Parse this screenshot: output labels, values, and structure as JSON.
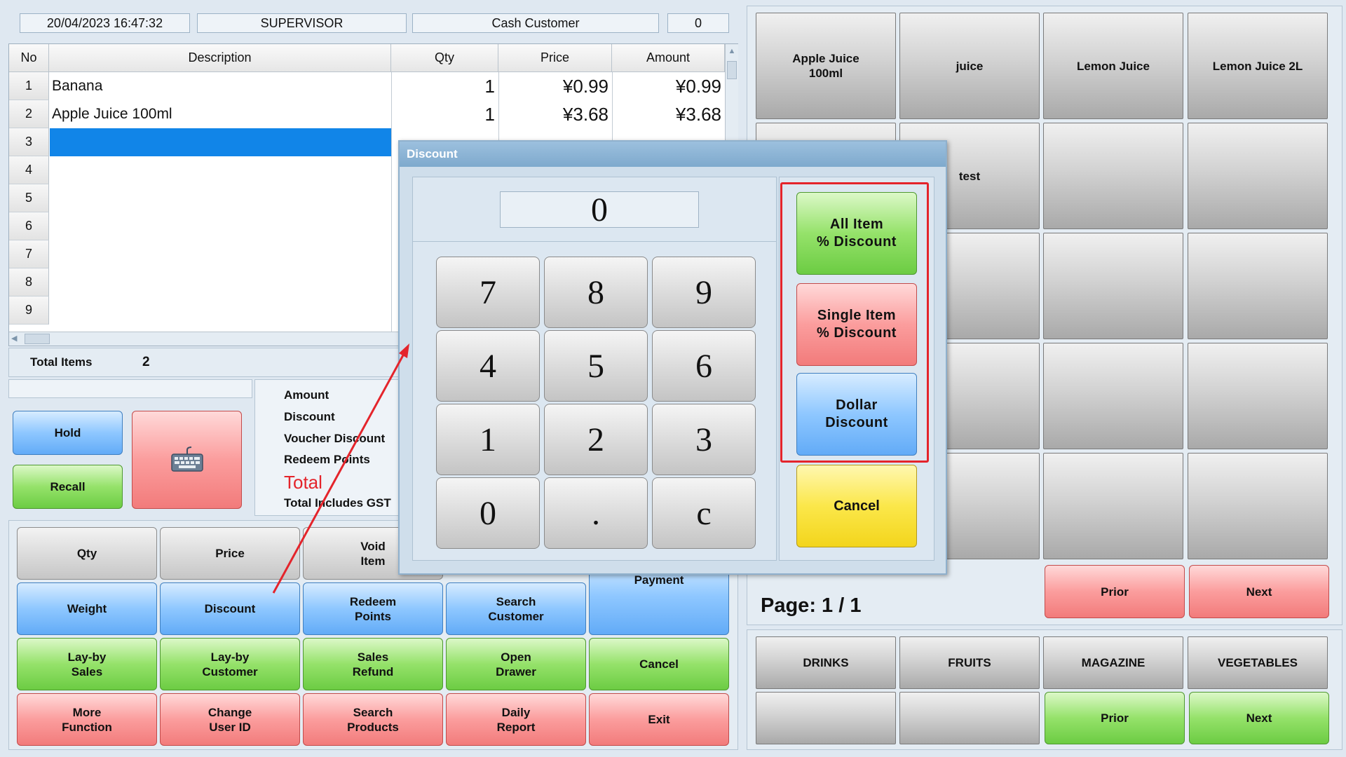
{
  "header": {
    "datetime": "20/04/2023  16:47:32",
    "user": "SUPERVISOR",
    "customer": "Cash Customer",
    "counter": "0"
  },
  "grid": {
    "columns": [
      "No",
      "Description",
      "Qty",
      "Price",
      "Amount"
    ],
    "rows": [
      {
        "no": "1",
        "description": "Banana",
        "qty": "1",
        "price": "¥0.99",
        "amount": "¥0.99"
      },
      {
        "no": "2",
        "description": "Apple Juice 100ml",
        "qty": "1",
        "price": "¥3.68",
        "amount": "¥3.68"
      },
      {
        "no": "3"
      },
      {
        "no": "4"
      },
      {
        "no": "5"
      },
      {
        "no": "6"
      },
      {
        "no": "7"
      },
      {
        "no": "8"
      },
      {
        "no": "9"
      }
    ]
  },
  "totals": {
    "total_items_label": "Total Items",
    "total_items_value": "2",
    "amount_label": "Amount",
    "discount_label": "Discount",
    "voucher_label": "Voucher Discount",
    "redeem_label": "Redeem Points",
    "total_label": "Total",
    "gst_label": "Total Includes GST"
  },
  "side_buttons": {
    "hold": "Hold",
    "recall": "Recall",
    "keyboard_icon": "keyboard-icon"
  },
  "function_buttons": {
    "qty": "Qty",
    "price": "Price",
    "void_item": "Void\nItem",
    "payment": "Payment",
    "weight": "Weight",
    "discount": "Discount",
    "redeem_points": "Redeem\nPoints",
    "search_customer": "Search\nCustomer",
    "layby_sales": "Lay-by\nSales",
    "layby_customer": "Lay-by\nCustomer",
    "sales_refund": "Sales\nRefund",
    "open_drawer": "Open\nDrawer",
    "cancel": "Cancel",
    "more_function": "More\nFunction",
    "change_user": "Change\nUser ID",
    "search_products": "Search\nProducts",
    "daily_report": "Daily\nReport",
    "exit": "Exit"
  },
  "products": {
    "tiles": [
      "Apple Juice\n100ml",
      "juice",
      "Lemon Juice",
      "Lemon Juice 2L",
      "",
      "test",
      "",
      ""
    ],
    "page_label": "Page: 1 / 1",
    "prior": "Prior",
    "next": "Next"
  },
  "categories": {
    "tiles": [
      "DRINKS",
      "FRUITS",
      "MAGAZINE",
      "VEGETABLES"
    ],
    "prior": "Prior",
    "next": "Next"
  },
  "dialog": {
    "title": "Discount",
    "display_value": "0",
    "keys": [
      "7",
      "8",
      "9",
      "4",
      "5",
      "6",
      "1",
      "2",
      "3",
      "0",
      ".",
      "c"
    ],
    "all_item": "All Item\n% Discount",
    "single_item": "Single Item\n% Discount",
    "dollar": "Dollar\nDiscount",
    "cancel": "Cancel"
  },
  "colors": {
    "highlight_box": "#e4242b",
    "arrow": "#e4242b",
    "selected_row": "#1185e8",
    "total_text": "#e4242b"
  }
}
